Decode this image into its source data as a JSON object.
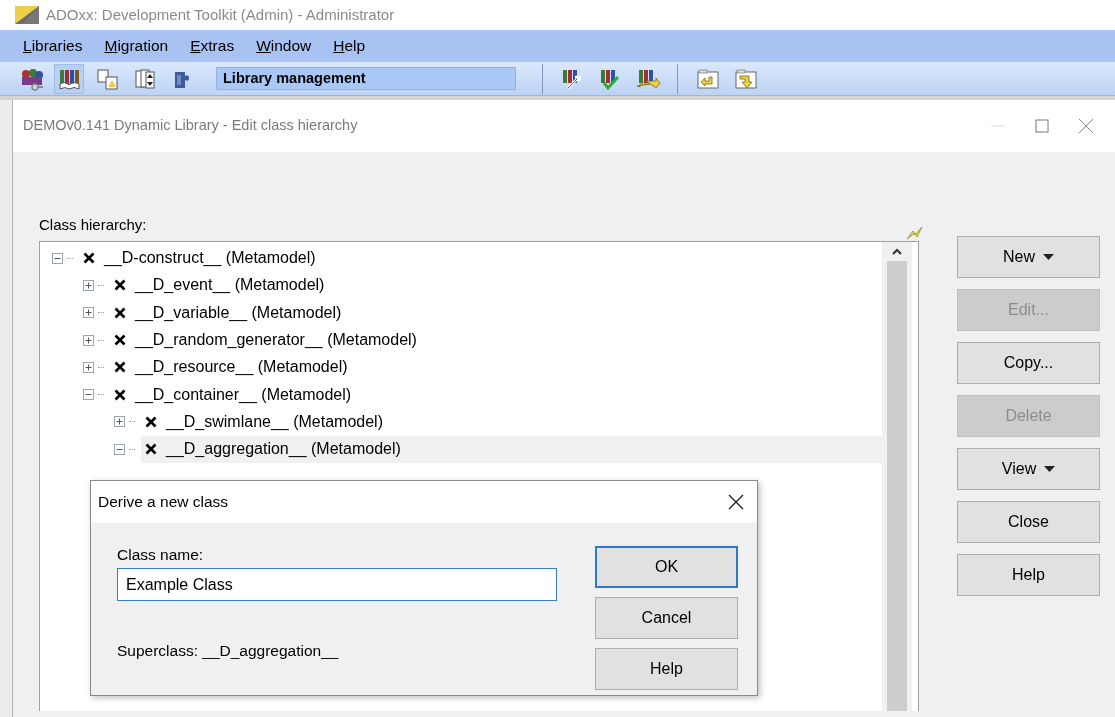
{
  "app_window": {
    "title": "ADOxx: Development Toolkit (Admin) - Administrator"
  },
  "menu": [
    {
      "label": "Libraries"
    },
    {
      "label": "Migration"
    },
    {
      "label": "Extras"
    },
    {
      "label": "Window"
    },
    {
      "label": "Help"
    }
  ],
  "toolbar": {
    "left_tools": [
      {
        "selected": false
      },
      {
        "selected": true
      },
      {
        "selected": false
      },
      {
        "selected": false
      },
      {
        "selected": false
      }
    ],
    "mode_label": "Library management",
    "library_tools": [
      {
        "selected": false
      },
      {
        "selected": false
      },
      {
        "selected": false
      }
    ],
    "transfer_tools": [
      {
        "selected": false
      },
      {
        "selected": false
      }
    ]
  },
  "edit_window": {
    "title": "DEMOv0.141 Dynamic Library - Edit class hierarchy",
    "hierarchy_label": "Class hierarchy:",
    "tree": [
      {
        "label": "__D-construct__ (Metamodel)",
        "expanded": true,
        "selected": false,
        "children": [
          {
            "label": "__D_event__ (Metamodel)",
            "expanded": false,
            "selected": false
          },
          {
            "label": "__D_variable__ (Metamodel)",
            "expanded": false,
            "selected": false
          },
          {
            "label": "__D_random_generator__ (Metamodel)",
            "expanded": false,
            "selected": false
          },
          {
            "label": "__D_resource__ (Metamodel)",
            "expanded": false,
            "selected": false
          },
          {
            "label": "__D_container__ (Metamodel)",
            "expanded": true,
            "selected": false,
            "children": [
              {
                "label": "__D_swimlane__ (Metamodel)",
                "expanded": false,
                "selected": false
              },
              {
                "label": "__D_aggregation__ (Metamodel)",
                "expanded": true,
                "selected": true
              }
            ]
          }
        ]
      }
    ],
    "buttons": [
      {
        "label": "New",
        "disabled": false,
        "dropdown": true
      },
      {
        "label": "Edit...",
        "disabled": true,
        "dropdown": false
      },
      {
        "label": "Copy...",
        "disabled": false,
        "dropdown": false
      },
      {
        "label": "Delete",
        "disabled": true,
        "dropdown": false
      },
      {
        "label": "View",
        "disabled": false,
        "dropdown": true
      },
      {
        "label": "Close",
        "disabled": false,
        "dropdown": false
      },
      {
        "label": "Help",
        "disabled": false,
        "dropdown": false
      }
    ]
  },
  "derive_dialog": {
    "title": "Derive a new class",
    "field_label": "Class name:",
    "value": "Example Class",
    "superclass": "Superclass: __D_aggregation__",
    "buttons": [
      {
        "label": "OK",
        "default": true
      },
      {
        "label": "Cancel",
        "default": false
      },
      {
        "label": "Help",
        "default": false
      }
    ]
  }
}
